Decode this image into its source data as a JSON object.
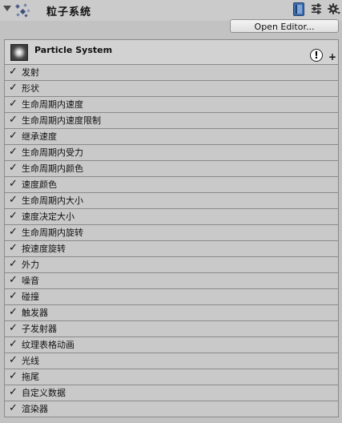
{
  "header": {
    "title": "粒子系统",
    "open_editor_label": "Open Editor..."
  },
  "particle_system": {
    "label": "Particle System",
    "warning_glyph": "!",
    "add_glyph": "+"
  },
  "modules": [
    {
      "label": "发射",
      "enabled": true
    },
    {
      "label": "形状",
      "enabled": true
    },
    {
      "label": "生命周期内速度",
      "enabled": true
    },
    {
      "label": "生命周期内速度限制",
      "enabled": true
    },
    {
      "label": "继承速度",
      "enabled": true
    },
    {
      "label": "生命周期内受力",
      "enabled": true
    },
    {
      "label": "生命周期内颜色",
      "enabled": true
    },
    {
      "label": "速度颜色",
      "enabled": true
    },
    {
      "label": "生命周期内大小",
      "enabled": true
    },
    {
      "label": "速度决定大小",
      "enabled": true
    },
    {
      "label": "生命周期内旋转",
      "enabled": true
    },
    {
      "label": "按速度旋转",
      "enabled": true
    },
    {
      "label": "外力",
      "enabled": true
    },
    {
      "label": "噪音",
      "enabled": true
    },
    {
      "label": "碰撞",
      "enabled": true
    },
    {
      "label": "触发器",
      "enabled": true
    },
    {
      "label": "子发射器",
      "enabled": true
    },
    {
      "label": "纹理表格动画",
      "enabled": true
    },
    {
      "label": "光线",
      "enabled": true
    },
    {
      "label": "拖尾",
      "enabled": true
    },
    {
      "label": "自定义数据",
      "enabled": true
    },
    {
      "label": "渲染器",
      "enabled": true
    }
  ],
  "icons": {
    "foldout": "triangle-down-icon",
    "component": "particle-system-icon",
    "help": "book-icon",
    "presets": "preset-sliders-icon",
    "settings": "gear-icon",
    "warning": "exclamation-icon",
    "add": "plus-icon"
  },
  "check_glyph": "✓"
}
